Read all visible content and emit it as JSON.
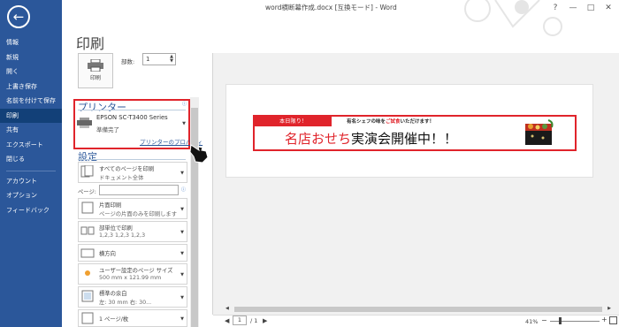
{
  "window": {
    "title": "word横断幕作成.docx [互換モード] - Word",
    "controls": {
      "help": "?",
      "minimize": "—",
      "restore": "□",
      "close": "✕"
    }
  },
  "nav": {
    "back_icon": "back-arrow-icon",
    "items": [
      {
        "label": "情報",
        "active": false
      },
      {
        "label": "新規",
        "active": false
      },
      {
        "label": "開く",
        "active": false
      },
      {
        "label": "上書き保存",
        "active": false
      },
      {
        "label": "名前を付けて保存",
        "active": false
      },
      {
        "label": "印刷",
        "active": true
      },
      {
        "label": "共有",
        "active": false
      },
      {
        "label": "エクスポート",
        "active": false
      },
      {
        "label": "閉じる",
        "active": false
      },
      {
        "label": "アカウント",
        "active": false
      },
      {
        "label": "オプション",
        "active": false
      },
      {
        "label": "フィードバック",
        "active": false
      }
    ]
  },
  "print": {
    "heading": "印刷",
    "print_button_label": "印刷",
    "copies_label": "部数:",
    "copies_value": "1"
  },
  "printer": {
    "section_label": "プリンター",
    "name": "EPSON SC-T3400 Series",
    "status": "準備完了",
    "properties_link": "プリンターのプロパティ",
    "info": "ⓘ"
  },
  "settings": {
    "section_label": "設定",
    "pages_label": "ページ:",
    "pages_value": "",
    "info": "ⓘ",
    "items": [
      {
        "line1": "すべてのページを印刷",
        "line2": "ドキュメント全体"
      },
      {
        "line1": "片面印刷",
        "line2": "ページの片面のみを印刷します"
      },
      {
        "line1": "部単位で印刷",
        "line2": "1,2,3    1,2,3    1,2,3"
      },
      {
        "line1": "横方向",
        "line2": ""
      },
      {
        "line1": "ユーザー設定のページ サイズ",
        "line2": "500 mm x 121.99 mm"
      },
      {
        "line1": "標準の余白",
        "line2": "左: 30 mm    右: 30..."
      },
      {
        "line1": "1 ページ/枚",
        "line2": ""
      }
    ]
  },
  "preview": {
    "tag": "本日限り！",
    "subline_pre": "有名シェフの味を",
    "subline_red": "ご試食",
    "subline_post": "いただけます！",
    "headline_red": "名店おせち",
    "headline_black": "実演会開催中！！"
  },
  "footer": {
    "prev": "◀",
    "current_page": "1",
    "total": "/ 1",
    "next": "▶",
    "zoom": "41%",
    "zoom_minus": "−",
    "zoom_plus": "+"
  },
  "colors": {
    "accent": "#2b579a",
    "highlight": "#e0242b"
  }
}
